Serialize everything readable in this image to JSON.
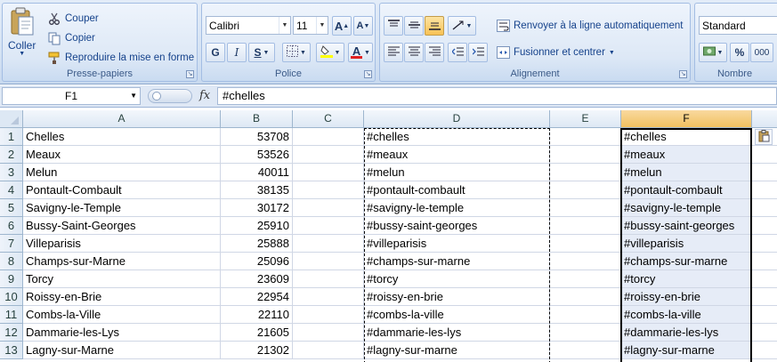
{
  "ribbon": {
    "clipboard": {
      "paste_label": "Coller",
      "cut_label": "Couper",
      "copy_label": "Copier",
      "format_painter_label": "Reproduire la mise en forme",
      "group_label": "Presse-papiers"
    },
    "font": {
      "font_name": "Calibri",
      "font_size": "11",
      "bold": "G",
      "italic": "I",
      "underline": "S",
      "grow": "A",
      "shrink": "A",
      "font_color_letter": "A",
      "group_label": "Police"
    },
    "alignment": {
      "wrap_label": "Renvoyer à la ligne automatiquement",
      "merge_label": "Fusionner et centrer",
      "group_label": "Alignement"
    },
    "number": {
      "format": "Standard",
      "percent": "%",
      "thousands": "000",
      "group_label": "Nombre"
    }
  },
  "formula_bar": {
    "name_box": "F1",
    "fx": "fx",
    "formula": "#chelles"
  },
  "columns": [
    "A",
    "B",
    "C",
    "D",
    "E",
    "F"
  ],
  "rows": [
    {
      "num": "1",
      "a": "Chelles",
      "b": "53708",
      "d": "#chelles",
      "f": "#chelles"
    },
    {
      "num": "2",
      "a": "Meaux",
      "b": "53526",
      "d": "#meaux",
      "f": "#meaux"
    },
    {
      "num": "3",
      "a": "Melun",
      "b": "40011",
      "d": "#melun",
      "f": "#melun"
    },
    {
      "num": "4",
      "a": "Pontault-Combault",
      "b": "38135",
      "d": "#pontault-combault",
      "f": "#pontault-combault"
    },
    {
      "num": "5",
      "a": "Savigny-le-Temple",
      "b": "30172",
      "d": "#savigny-le-temple",
      "f": "#savigny-le-temple"
    },
    {
      "num": "6",
      "a": "Bussy-Saint-Georges",
      "b": "25910",
      "d": "#bussy-saint-georges",
      "f": "#bussy-saint-georges"
    },
    {
      "num": "7",
      "a": "Villeparisis",
      "b": "25888",
      "d": "#villeparisis",
      "f": "#villeparisis"
    },
    {
      "num": "8",
      "a": "Champs-sur-Marne",
      "b": "25096",
      "d": "#champs-sur-marne",
      "f": "#champs-sur-marne"
    },
    {
      "num": "9",
      "a": "Torcy",
      "b": "23609",
      "d": "#torcy",
      "f": "#torcy"
    },
    {
      "num": "10",
      "a": "Roissy-en-Brie",
      "b": "22954",
      "d": "#roissy-en-brie",
      "f": "#roissy-en-brie"
    },
    {
      "num": "11",
      "a": "Combs-la-Ville",
      "b": "22110",
      "d": "#combs-la-ville",
      "f": "#combs-la-ville"
    },
    {
      "num": "12",
      "a": "Dammarie-les-Lys",
      "b": "21605",
      "d": "#dammarie-les-lys",
      "f": "#dammarie-les-lys"
    },
    {
      "num": "13",
      "a": "Lagny-sur-Marne",
      "b": "21302",
      "d": "#lagny-sur-marne",
      "f": "#lagny-sur-marne"
    }
  ],
  "colors": {
    "selected_column_header": "#f1c15f",
    "selected_range": "#e6ecf7",
    "ribbon_text": "#15428b"
  }
}
